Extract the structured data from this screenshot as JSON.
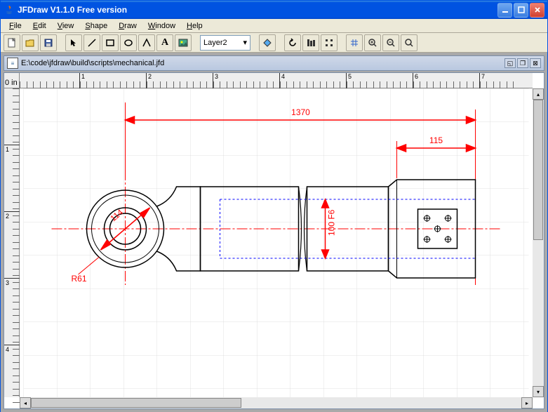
{
  "window": {
    "title": "JFDraw V1.1.0 Free version"
  },
  "menus": {
    "file": "File",
    "edit": "Edit",
    "view": "View",
    "shape": "Shape",
    "draw": "Draw",
    "window": "Window",
    "help": "Help"
  },
  "toolbar": {
    "layer": "Layer2"
  },
  "document": {
    "path": "E:\\code\\jfdraw\\build\\scripts\\mechanical.jfd"
  },
  "ruler": {
    "unit": "0 in",
    "hticks": [
      "1",
      "2",
      "3",
      "4",
      "5",
      "6",
      "7"
    ],
    "vticks": [
      "1",
      "2",
      "3",
      "4"
    ]
  },
  "drawing": {
    "dim1": "1370",
    "dim2": "115",
    "dim3": "114",
    "dim4": "R61",
    "dim5": "100 F6"
  },
  "colors": {
    "dim": "#ff0000",
    "center": "#ff0000",
    "hidden": "#0000ff"
  }
}
